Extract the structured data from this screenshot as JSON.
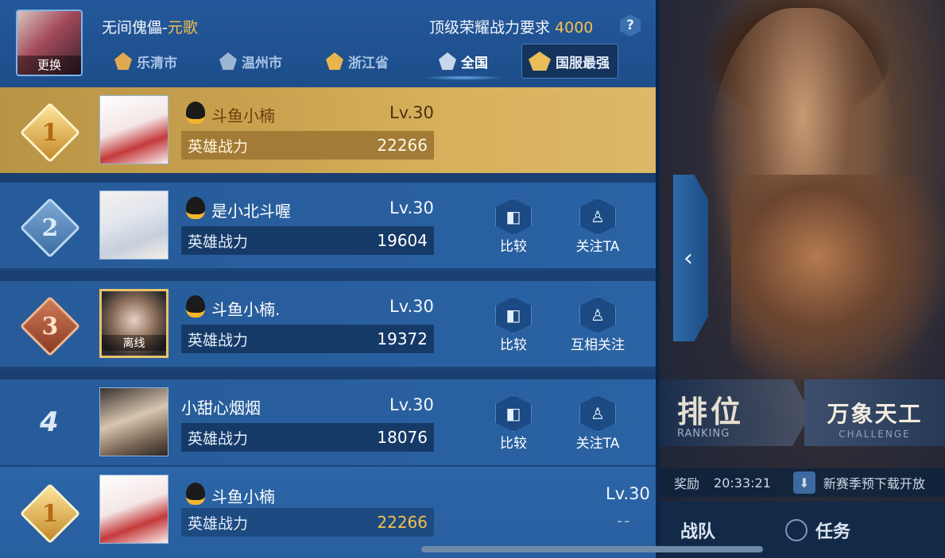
{
  "header": {
    "hero_label": "无间傀儡-",
    "hero_name": "元歌",
    "change_label": "更换",
    "requirement_label": "顶级荣耀战力要求 ",
    "requirement_value": "4000",
    "help": "?"
  },
  "tabs": [
    {
      "label": "乐清市",
      "icon": "city-badge-icon"
    },
    {
      "label": "温州市",
      "icon": "city-badge-icon"
    },
    {
      "label": "浙江省",
      "icon": "province-badge-icon"
    },
    {
      "label": "全国",
      "icon": "national-badge-icon",
      "active": true
    },
    {
      "label": "国服最强",
      "icon": "top-server-badge-icon"
    }
  ],
  "rows": [
    {
      "rank": "1",
      "name": "斗鱼小楠",
      "level": "Lv.30",
      "power_label": "英雄战力",
      "power": "22266"
    },
    {
      "rank": "2",
      "name": "是小北斗喔",
      "level": "Lv.30",
      "power_label": "英雄战力",
      "power": "19604",
      "actions": [
        "比较",
        "关注TA"
      ]
    },
    {
      "rank": "3",
      "name": "斗鱼小楠.",
      "level": "Lv.30",
      "power_label": "英雄战力",
      "power": "19372",
      "offline": "离线",
      "actions": [
        "比较",
        "互相关注"
      ]
    },
    {
      "rank": "4",
      "name": "小甜心烟烟",
      "level": "Lv.30",
      "power_label": "英雄战力",
      "power": "18076",
      "actions": [
        "比较",
        "关注TA"
      ]
    }
  ],
  "me": {
    "rank": "1",
    "name": "斗鱼小楠",
    "level": "Lv.30",
    "power_label": "英雄战力",
    "power": "22266",
    "extra": "--"
  },
  "right": {
    "ranking_big": "排位",
    "ranking_sub": "RANKING",
    "challenge_big": "万象天工",
    "challenge_sub": "CHALLENGE",
    "reward": "奖励",
    "time": "20:33:21",
    "news": "新赛季预下载开放",
    "team": "战队",
    "task": "任务"
  },
  "colors": {
    "gold_text": "#f2c14b",
    "panel_blue": "#1b4478"
  }
}
